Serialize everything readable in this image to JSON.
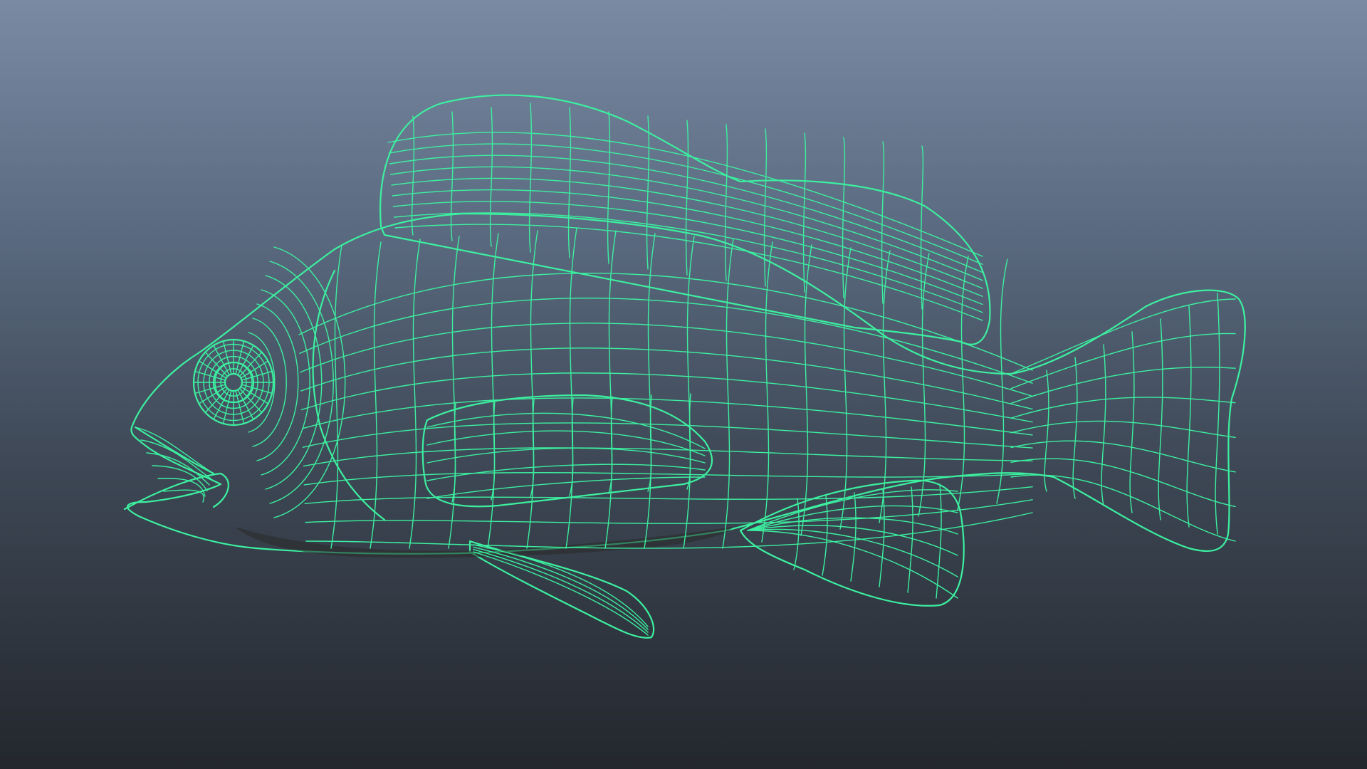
{
  "viewport": {
    "background_top": "#7a8aa3",
    "background_bottom": "#23272d",
    "mesh_color": "#3cf0a0",
    "surface_color": "#7c7c7c"
  },
  "model": {
    "subject": "fish",
    "display_mode": "wireframe-on-shaded"
  }
}
